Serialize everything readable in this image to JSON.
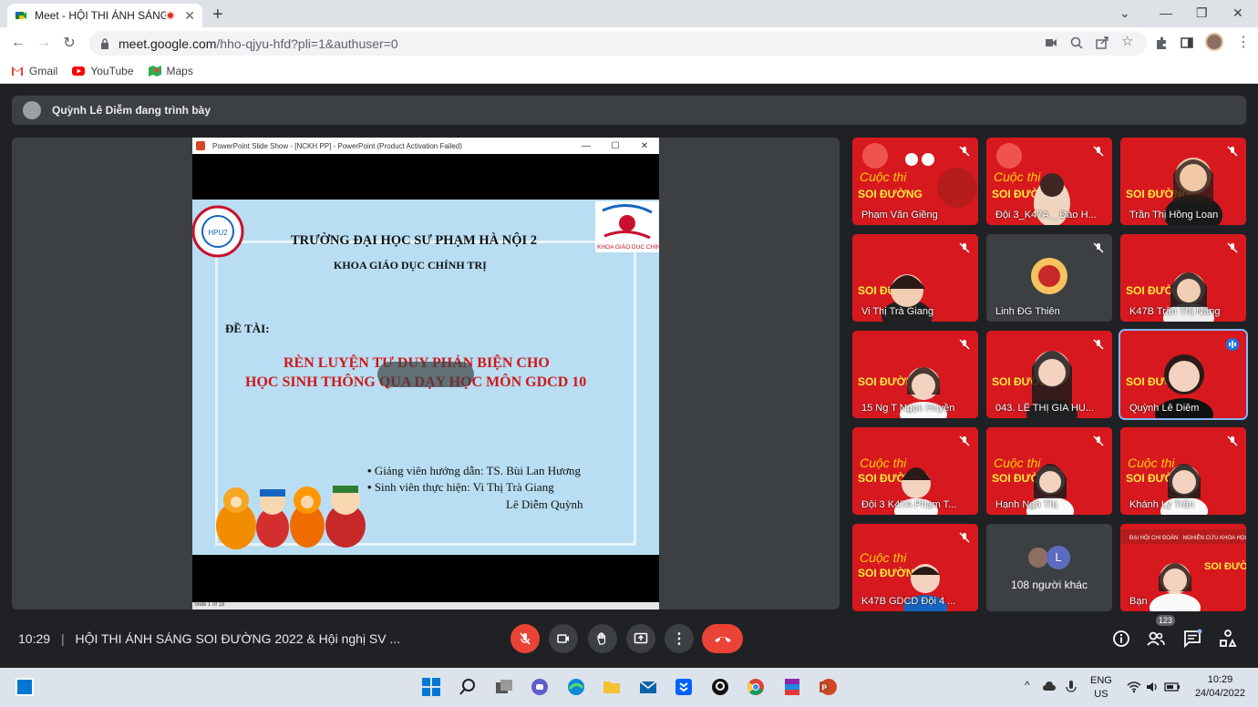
{
  "browser": {
    "tab_title": "Meet - HỘI THI ÁNH SÁNG SO",
    "url_host": "meet.google.com",
    "url_path": "/hho-qjyu-hfd?pli=1&authuser=0",
    "bookmarks": [
      "Gmail",
      "YouTube",
      "Maps"
    ]
  },
  "meet": {
    "presenting_label": "Quỳnh Lê Diễm đang trình bày",
    "meeting_time": "10:29",
    "meeting_title": "HỘI THI ÁNH SÁNG SOI ĐƯỜNG 2022 & Hội nghị SV ...",
    "participant_count": "123"
  },
  "slide": {
    "window_title": "PowerPoint Slide Show - [NCKH PP] - PowerPoint (Product Activation Failed)",
    "school": "TRƯỜNG ĐẠI HỌC SƯ PHẠM HÀ NỘI 2",
    "faculty": "KHOA GIÁO DỤC CHÍNH TRỊ",
    "topic_label": "ĐỀ TÀI:",
    "topic_line1": "RÈN LUYỆN TƯ DUY PHẢN BIỆN CHO",
    "topic_line2": "HỌC SINH THÔNG QUA DẠY HỌC MÔN GDCD 10",
    "advisor": "Giảng viên hướng dẫn: TS. Bùi Lan Hương",
    "students_label": "Sinh viên thực hiện: Vi Thị Trà Giang",
    "student2": "Lê Diễm Quỳnh",
    "status": "Slide 1 of 18"
  },
  "tiles": [
    {
      "name": "Phạm Văn Giềng"
    },
    {
      "name": "Đội 3_K47A _ Đào H..."
    },
    {
      "name": "Trần Thị Hồng Loan"
    },
    {
      "name": "Vi Thị Trà Giang"
    },
    {
      "name": "Linh ĐG Thiên"
    },
    {
      "name": "K47B Trần Thị Năng"
    },
    {
      "name": "15 Ng T Ngọc Huyền"
    },
    {
      "name": "043. LÊ THỊ GIA HU..."
    },
    {
      "name": "Quỳnh Lê Diễm"
    },
    {
      "name": "Đội 3 K47A Phạm T..."
    },
    {
      "name": "Hạnh Ngô Thị"
    },
    {
      "name": "Khánh Ly Trần"
    },
    {
      "name": "K47B GDCD Đội 4 ..."
    },
    {
      "name": "108 người khác"
    },
    {
      "name": "Bạn"
    }
  ],
  "others_initial": "L",
  "taskbar": {
    "lang1": "ENG",
    "lang2": "US",
    "time": "10:29",
    "date": "24/04/2022"
  }
}
